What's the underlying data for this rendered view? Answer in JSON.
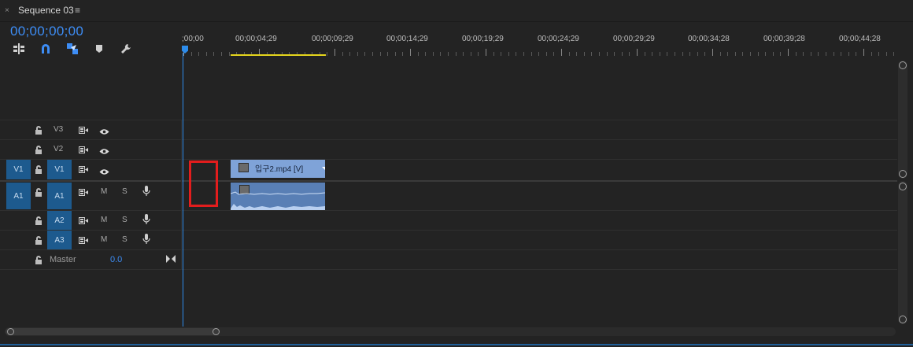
{
  "panel": {
    "close_glyph": "×",
    "title": "Sequence 03",
    "menu_glyph": "≡",
    "timecode": "00;00;00;00"
  },
  "toolbar": {
    "icons": [
      "insert-sequence-nest-icon",
      "snap-magnet-icon",
      "linked-selection-icon",
      "add-marker-icon",
      "timeline-settings-wrench-icon"
    ]
  },
  "ruler": {
    "labels": [
      ";00;00",
      "00;00;04;29",
      "00;00;09;29",
      "00;00;14;29",
      "00;00;19;29",
      "00;00;24;29",
      "00;00;29;29",
      "00;00;34;28",
      "00;00;39;28",
      "00;00;44;28"
    ]
  },
  "tracks": {
    "v3": {
      "name": "V3"
    },
    "v2": {
      "name": "V2"
    },
    "v1": {
      "source": "V1",
      "name": "V1"
    },
    "a1": {
      "source": "A1",
      "name": "A1",
      "mute": "M",
      "solo": "S"
    },
    "a2": {
      "name": "A2",
      "mute": "M",
      "solo": "S"
    },
    "a3": {
      "name": "A3",
      "mute": "M",
      "solo": "S"
    },
    "master": {
      "name": "Master",
      "value": "0.0"
    }
  },
  "clips": {
    "video": {
      "name": "입구2.mp4 [V]"
    }
  },
  "colors": {
    "accent": "#2d8ceb",
    "timecode": "#3d8df5",
    "work_area": "#e5d51d",
    "video_clip": "#7fa3d8",
    "audio_clip": "#597fb5",
    "highlight_box": "#e31d1d",
    "track_target": "#1d5a8e"
  }
}
